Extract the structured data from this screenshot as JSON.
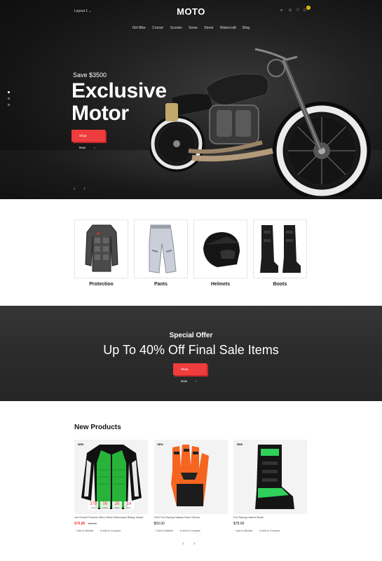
{
  "header": {
    "layout_select": "Layout 1",
    "logo": "MOTO",
    "cart_count": "0",
    "nav": [
      "Dirt Bike",
      "Cruiser",
      "Scooter",
      "Snow",
      "Street",
      "Watercraft",
      "Blog"
    ]
  },
  "hero": {
    "save": "Save $3500",
    "title_line1": "Exclusive",
    "title_line2": "Motor",
    "button": "Shop Now",
    "prev": "‹",
    "next": "›"
  },
  "categories": [
    {
      "label": "Protection"
    },
    {
      "label": "Pants"
    },
    {
      "label": "Helmets"
    },
    {
      "label": "Boots"
    }
  ],
  "offer": {
    "subtitle": "Special Offer",
    "title": "Up To 40% Off Final Sale Items",
    "button": "Shop Now"
  },
  "new_products": {
    "title": "New Products",
    "items": [
      {
        "badge": "NEW",
        "name": "Joe Rocket Phoenix Men's Mesh Motorcycle Riding Jacket",
        "price": "$79.80",
        "old_price": "$99.00",
        "countdown": [
          {
            "n": "379",
            "u": "Days"
          },
          {
            "n": "06",
            "u": "Hours"
          },
          {
            "n": "26",
            "u": "Mins"
          },
          {
            "n": "14",
            "u": "Secs"
          }
        ],
        "wishlist": "Add to Wishlist",
        "compare": "Add to Compare"
      },
      {
        "badge": "NEW",
        "name": "2015 Fox Racing Dirtpaw Race Gloves",
        "price": "$59.00",
        "wishlist": "Add to Wishlist",
        "compare": "Add to Compare"
      },
      {
        "badge": "NEW",
        "name": "Fox Racing Instinct Boots",
        "price": "$78.00",
        "wishlist": "Add to Wishlist",
        "compare": "Add to Compare"
      }
    ],
    "prev": "‹",
    "next": "›"
  },
  "colors": {
    "accent": "#ef3c3c",
    "cart_badge": "#f2c200",
    "dark": "#1a1a1a"
  }
}
